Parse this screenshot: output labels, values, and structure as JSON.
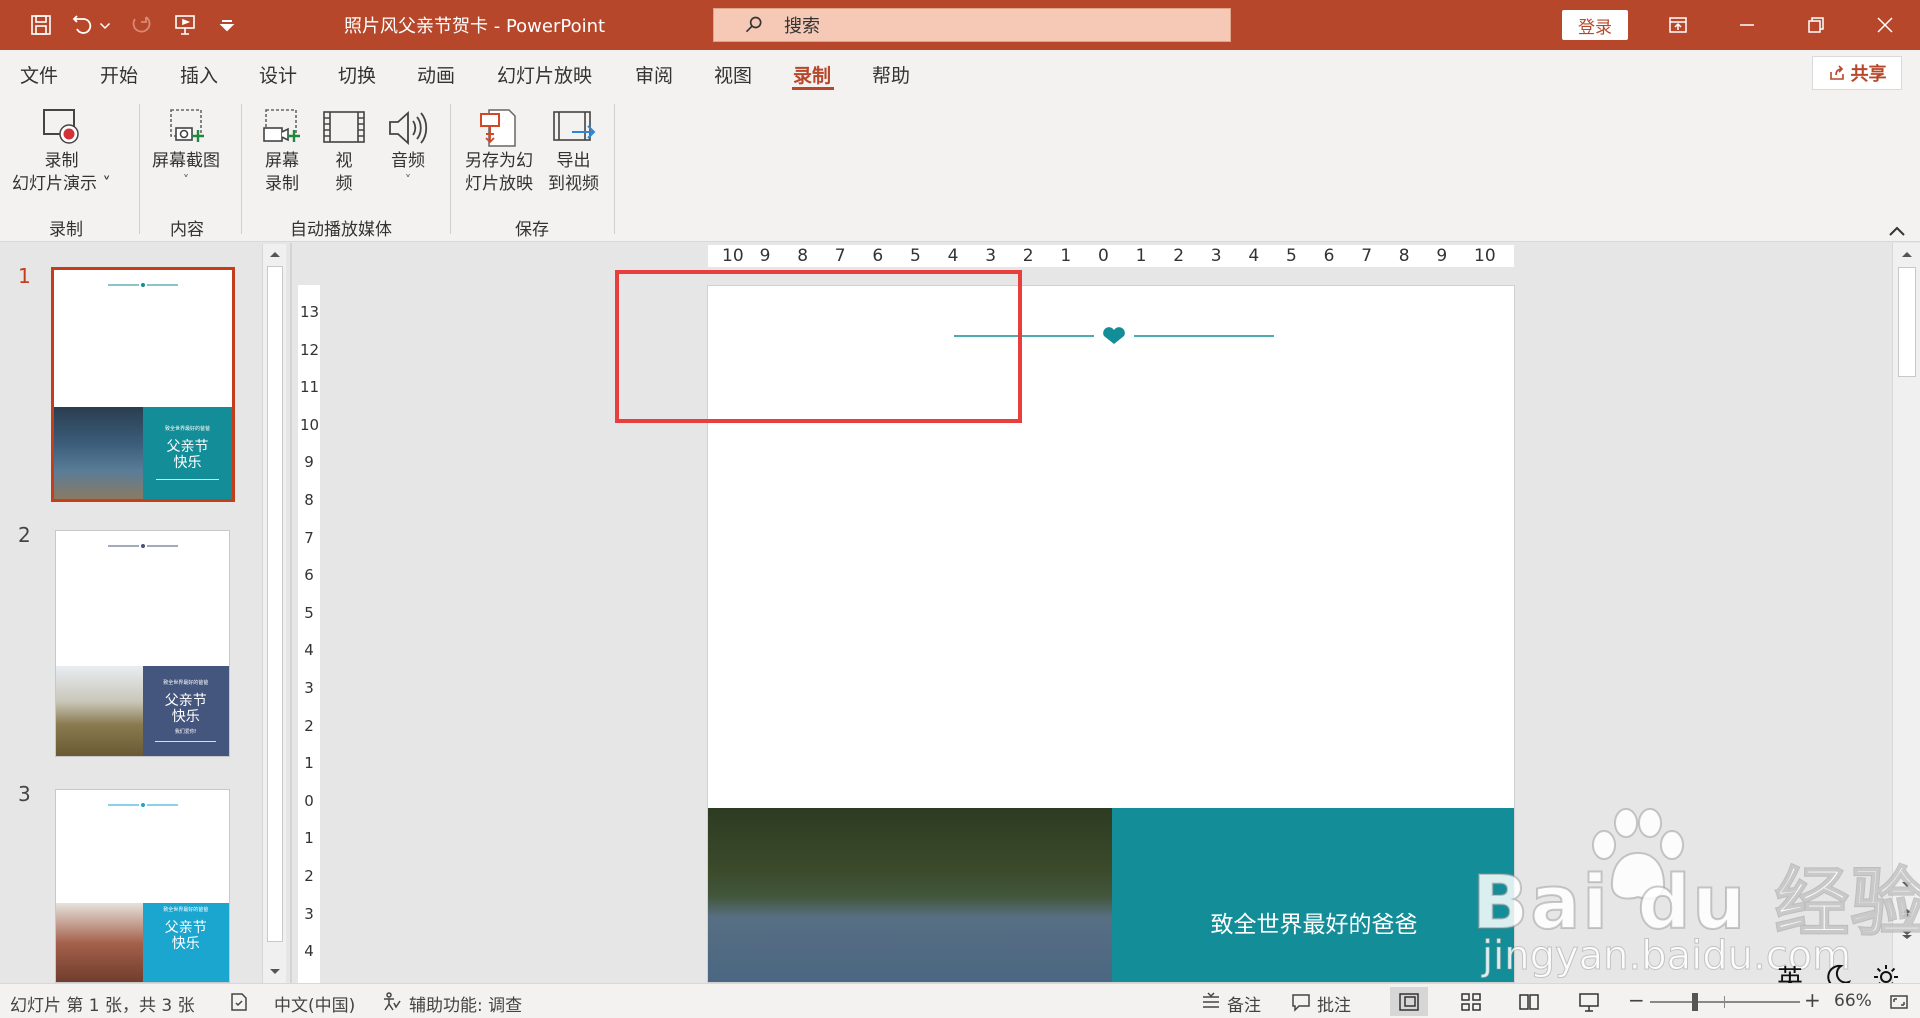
{
  "window": {
    "title": "照片风父亲节贺卡  -  PowerPoint",
    "search_placeholder": "搜索",
    "login_label": "登录"
  },
  "quick_access_icons": [
    "save-icon",
    "undo-icon",
    "redo-icon",
    "present-icon",
    "customize-icon"
  ],
  "menu": {
    "tabs": [
      "文件",
      "开始",
      "插入",
      "设计",
      "切换",
      "动画",
      "幻灯片放映",
      "审阅",
      "视图",
      "录制",
      "帮助"
    ],
    "active_tab": "录制",
    "share_label": "共享"
  },
  "ribbon": {
    "groups": [
      {
        "label": "录制",
        "buttons": [
          {
            "line1": "录制",
            "line2": "幻灯片演示 ˅",
            "icon": "record-slideshow-icon"
          }
        ]
      },
      {
        "label": "内容",
        "buttons": [
          {
            "line1": "屏幕截图",
            "line2": "˅",
            "icon": "screenshot-icon"
          }
        ]
      },
      {
        "label": "自动播放媒体",
        "buttons": [
          {
            "line1": "屏幕",
            "line2": "录制",
            "icon": "screen-recording-icon"
          },
          {
            "line1": "视",
            "line2": "频",
            "icon": "video-icon"
          },
          {
            "line1": "音频",
            "line2": "˅",
            "icon": "audio-icon"
          }
        ]
      },
      {
        "label": "保存",
        "buttons": [
          {
            "line1": "另存为幻",
            "line2": "灯片放映",
            "icon": "save-as-show-icon"
          },
          {
            "line1": "导出",
            "line2": "到视频",
            "icon": "export-video-icon"
          }
        ]
      }
    ]
  },
  "thumbnails": [
    {
      "number": "1",
      "selected": true,
      "panel_color": "#138e98",
      "deco_color": "#138e98",
      "small_text": "致全世界最好的爸爸",
      "title_line1": "父亲节",
      "title_line2": "快乐",
      "sub_text": ""
    },
    {
      "number": "2",
      "selected": false,
      "panel_color": "#44567e",
      "deco_color": "#44567e",
      "small_text": "致全世界最好的爸爸",
      "title_line1": "父亲节",
      "title_line2": "快乐",
      "sub_text": "我们爱你!"
    },
    {
      "number": "3",
      "selected": false,
      "panel_color": "#1aa6cf",
      "deco_color": "#1aa6cf",
      "small_text": "致全世界最好的爸爸",
      "title_line1": "父亲节",
      "title_line2": "快乐",
      "sub_text": ""
    }
  ],
  "rulers": {
    "horizontal": [
      "10",
      "9",
      "8",
      "7",
      "6",
      "5",
      "4",
      "3",
      "2",
      "1",
      "0",
      "1",
      "2",
      "3",
      "4",
      "5",
      "6",
      "7",
      "8",
      "9",
      "10"
    ],
    "vertical": [
      "13",
      "12",
      "11",
      "10",
      "9",
      "8",
      "7",
      "6",
      "5",
      "4",
      "3",
      "2",
      "1",
      "0",
      "1",
      "2",
      "3",
      "4"
    ]
  },
  "slide": {
    "accent_color": "#138e98",
    "subtitle": "致全世界最好的爸爸"
  },
  "annotation_color": "#e83e3e",
  "watermark": {
    "brand": "Bai  du 经验",
    "url": "jingyan.baidu.com"
  },
  "status": {
    "slide_info": "幻灯片 第 1 张，共 3 张",
    "language": "中文(中国)",
    "accessibility": "辅助功能: 调查",
    "notes_label": "备注",
    "comments_label": "批注",
    "zoom": "66%",
    "ime_lang": "英"
  },
  "colors": {
    "titlebar": "#b7472a",
    "accent": "#c43e1c"
  }
}
